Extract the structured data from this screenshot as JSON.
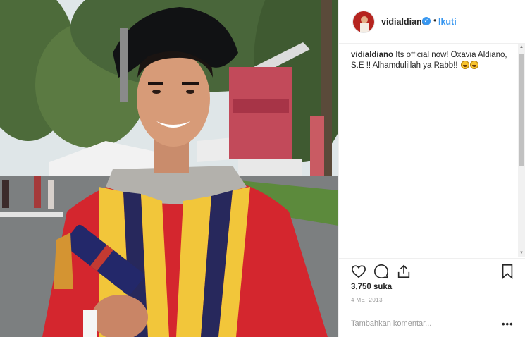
{
  "post": {
    "username": "vidialdiano",
    "verified_icon": "verified-badge-icon",
    "separator": "•",
    "follow_label": "Ikuti",
    "caption_user": "vidialdiano",
    "caption_text": "Its official now! Oxavia Aldiano, S.E !! Alhamdulillah ya Rabb!!",
    "caption_emoji": [
      "grinning-sweat-emoji",
      "grinning-sweat-emoji"
    ],
    "likes": "3,750 suka",
    "date": "4 MEI 2013",
    "comment_placeholder": "Tambahkan komentar...",
    "more_label": "•••"
  },
  "colors": {
    "accent": "#3897f0",
    "text": "#262626",
    "muted": "#999999"
  }
}
